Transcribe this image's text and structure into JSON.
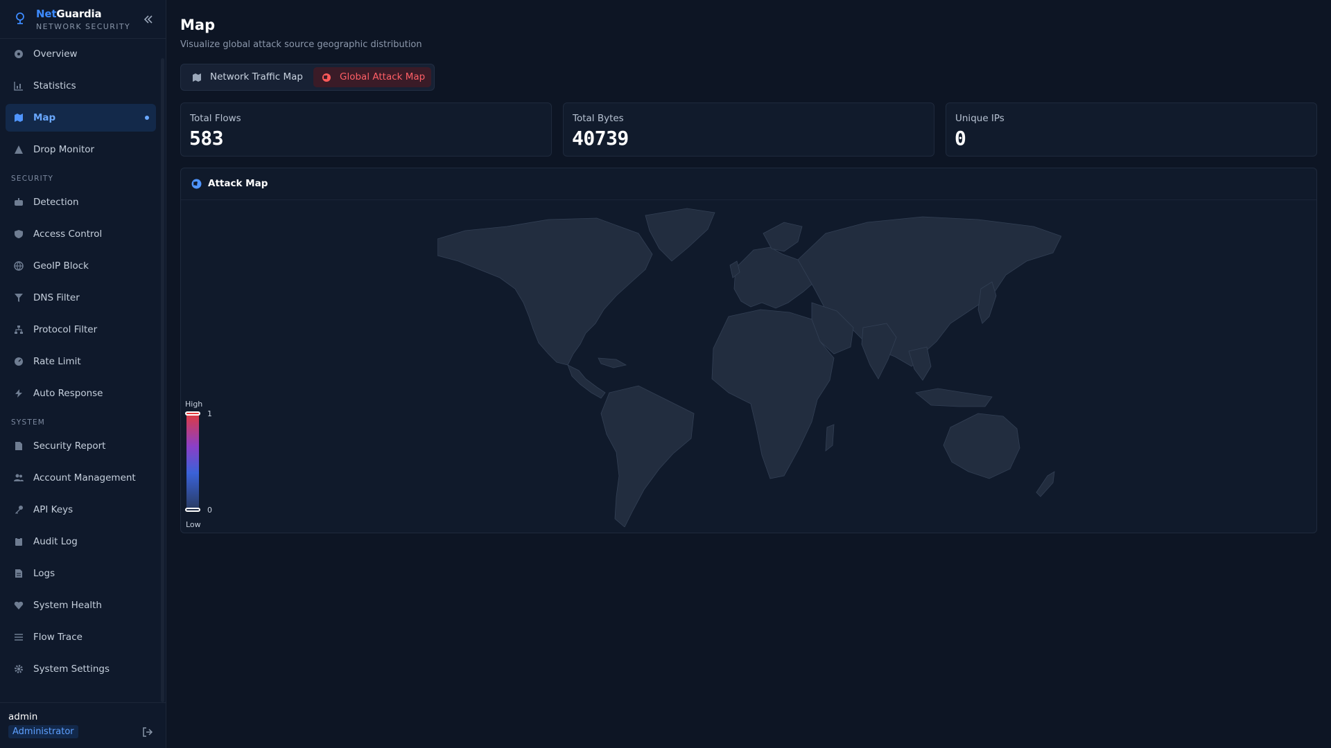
{
  "brand": {
    "name_accent": "Net",
    "name_rest": "Guardia",
    "subtitle": "NETWORK SECURITY"
  },
  "nav": {
    "items": [
      {
        "label": "Overview",
        "icon": "gauge-icon"
      },
      {
        "label": "Statistics",
        "icon": "bar-chart-icon"
      },
      {
        "label": "Map",
        "icon": "map-icon",
        "active": true
      },
      {
        "label": "Drop Monitor",
        "icon": "warning-triangle-icon"
      }
    ],
    "security_label": "SECURITY",
    "security_items": [
      {
        "label": "Detection",
        "icon": "robot-icon"
      },
      {
        "label": "Access Control",
        "icon": "shield-icon"
      },
      {
        "label": "GeoIP Block",
        "icon": "globe-icon"
      },
      {
        "label": "DNS Filter",
        "icon": "filter-icon"
      },
      {
        "label": "Protocol Filter",
        "icon": "sitemap-icon"
      },
      {
        "label": "Rate Limit",
        "icon": "tachometer-icon"
      },
      {
        "label": "Auto Response",
        "icon": "bolt-icon"
      }
    ],
    "system_label": "SYSTEM",
    "system_items": [
      {
        "label": "Security Report",
        "icon": "file-icon"
      },
      {
        "label": "Account Management",
        "icon": "users-icon"
      },
      {
        "label": "API Keys",
        "icon": "key-icon"
      },
      {
        "label": "Audit Log",
        "icon": "clipboard-icon"
      },
      {
        "label": "Logs",
        "icon": "document-icon"
      },
      {
        "label": "System Health",
        "icon": "heartbeat-icon"
      },
      {
        "label": "Flow Trace",
        "icon": "list-icon"
      },
      {
        "label": "System Settings",
        "icon": "gear-icon"
      }
    ]
  },
  "user": {
    "name": "admin",
    "role": "Administrator"
  },
  "page": {
    "title": "Map",
    "subtitle": "Visualize global attack source geographic distribution"
  },
  "tabs": [
    {
      "label": "Network Traffic Map",
      "icon": "map-icon"
    },
    {
      "label": "Global Attack Map",
      "icon": "globe-icon",
      "active": true
    }
  ],
  "stats": [
    {
      "label": "Total Flows",
      "value": "583"
    },
    {
      "label": "Total Bytes",
      "value": "40739"
    },
    {
      "label": "Unique IPs",
      "value": "0"
    }
  ],
  "map": {
    "title": "Attack Map",
    "legend": {
      "high": "High",
      "low": "Low",
      "max": "1",
      "min": "0"
    }
  },
  "colors": {
    "background": "#0d1524",
    "sidebar": "#0f192b",
    "accent": "#3d8bff",
    "danger": "#ff5a5a",
    "land": "#222d3f",
    "border_land": "#334055"
  }
}
